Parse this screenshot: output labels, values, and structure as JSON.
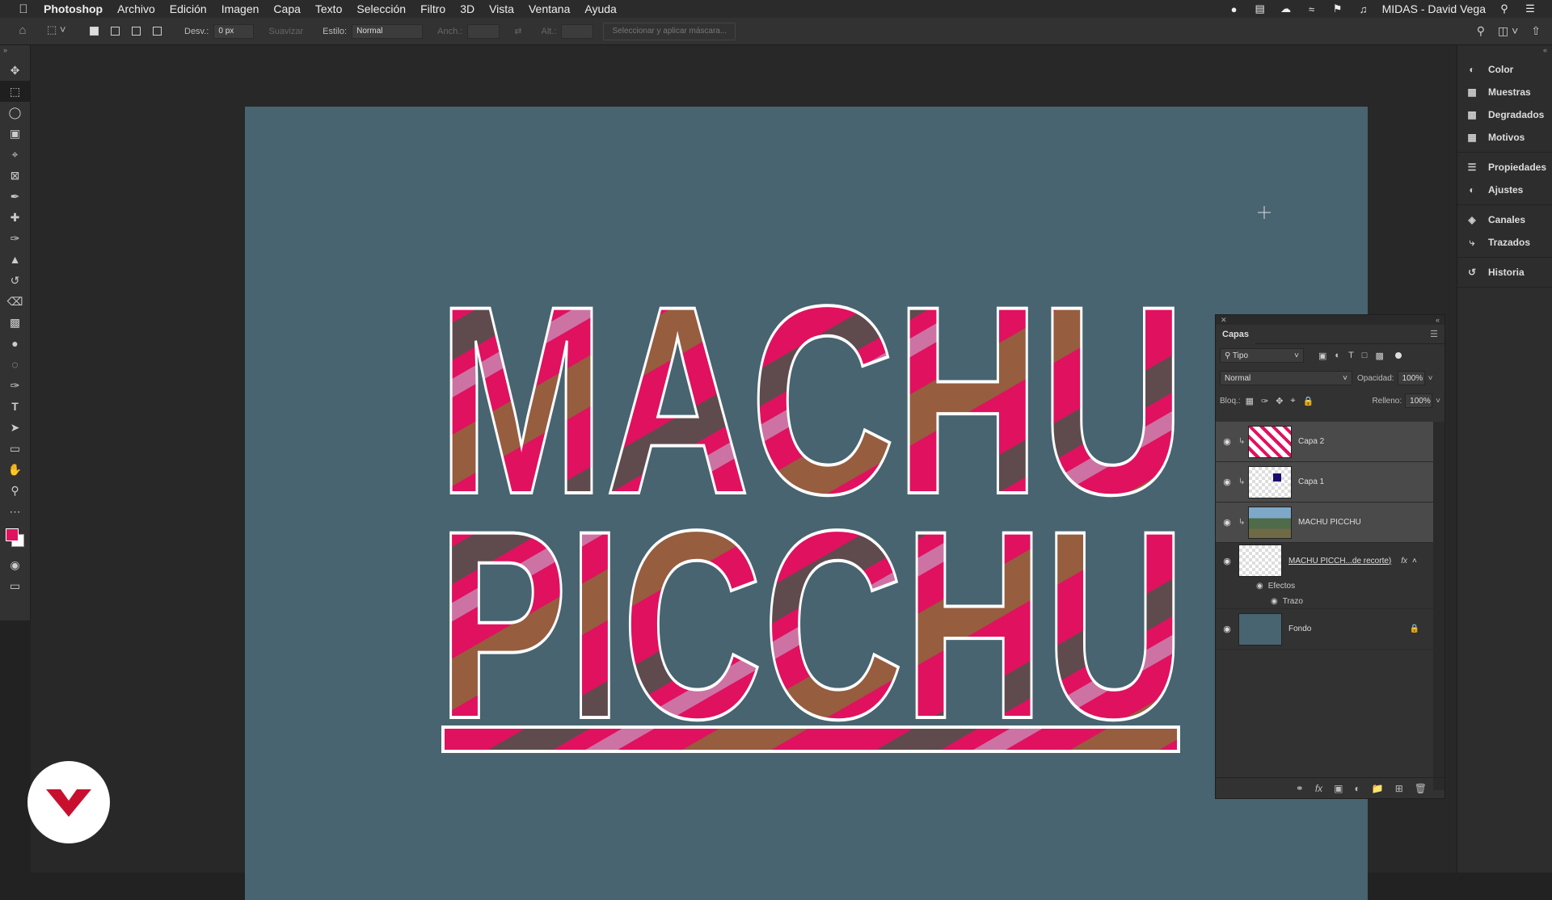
{
  "menubar": {
    "app_name": "Photoshop",
    "items": [
      "Archivo",
      "Edición",
      "Imagen",
      "Capa",
      "Texto",
      "Selección",
      "Filtro",
      "3D",
      "Vista",
      "Ventana",
      "Ayuda"
    ],
    "user": "MIDAS - David Vega"
  },
  "options": {
    "feather_label": "Desv.:",
    "feather_value": "0 px",
    "antialias_label": "Suavizar",
    "style_label": "Estilo:",
    "style_value": "Normal",
    "width_label": "Anch.:",
    "height_label": "Alt.:",
    "mask_button": "Seleccionar y aplicar máscara..."
  },
  "canvas": {
    "line1": "MACHU",
    "line2": "PICCHU",
    "background": "#476470",
    "accent": "#e0115f"
  },
  "dock": {
    "group1": [
      {
        "icon": "color-icon",
        "label": "Color"
      },
      {
        "icon": "swatches-icon",
        "label": "Muestras"
      },
      {
        "icon": "gradients-icon",
        "label": "Degradados"
      },
      {
        "icon": "patterns-icon",
        "label": "Motivos"
      }
    ],
    "group2": [
      {
        "icon": "properties-icon",
        "label": "Propiedades"
      },
      {
        "icon": "adjustments-icon",
        "label": "Ajustes"
      }
    ],
    "group3": [
      {
        "icon": "channels-icon",
        "label": "Canales"
      },
      {
        "icon": "paths-icon",
        "label": "Trazados"
      }
    ],
    "group4": [
      {
        "icon": "history-icon",
        "label": "Historia"
      }
    ]
  },
  "layers_panel": {
    "tab": "Capas",
    "filter_value": "Tipo",
    "blend_mode": "Normal",
    "opacity_label": "Opacidad:",
    "opacity_value": "100%",
    "lock_label": "Bloq.:",
    "fill_label": "Relleno:",
    "fill_value": "100%",
    "layers": [
      {
        "name": "Capa 2",
        "clipped": true
      },
      {
        "name": "Capa 1",
        "clipped": true
      },
      {
        "name": "MACHU PICCHU",
        "clipped": true
      },
      {
        "name": "MACHU PICCH...de recorte)",
        "fx": "fx",
        "effects_label": "Efectos",
        "effect": "Trazo"
      },
      {
        "name": "Fondo",
        "locked": true
      }
    ]
  }
}
